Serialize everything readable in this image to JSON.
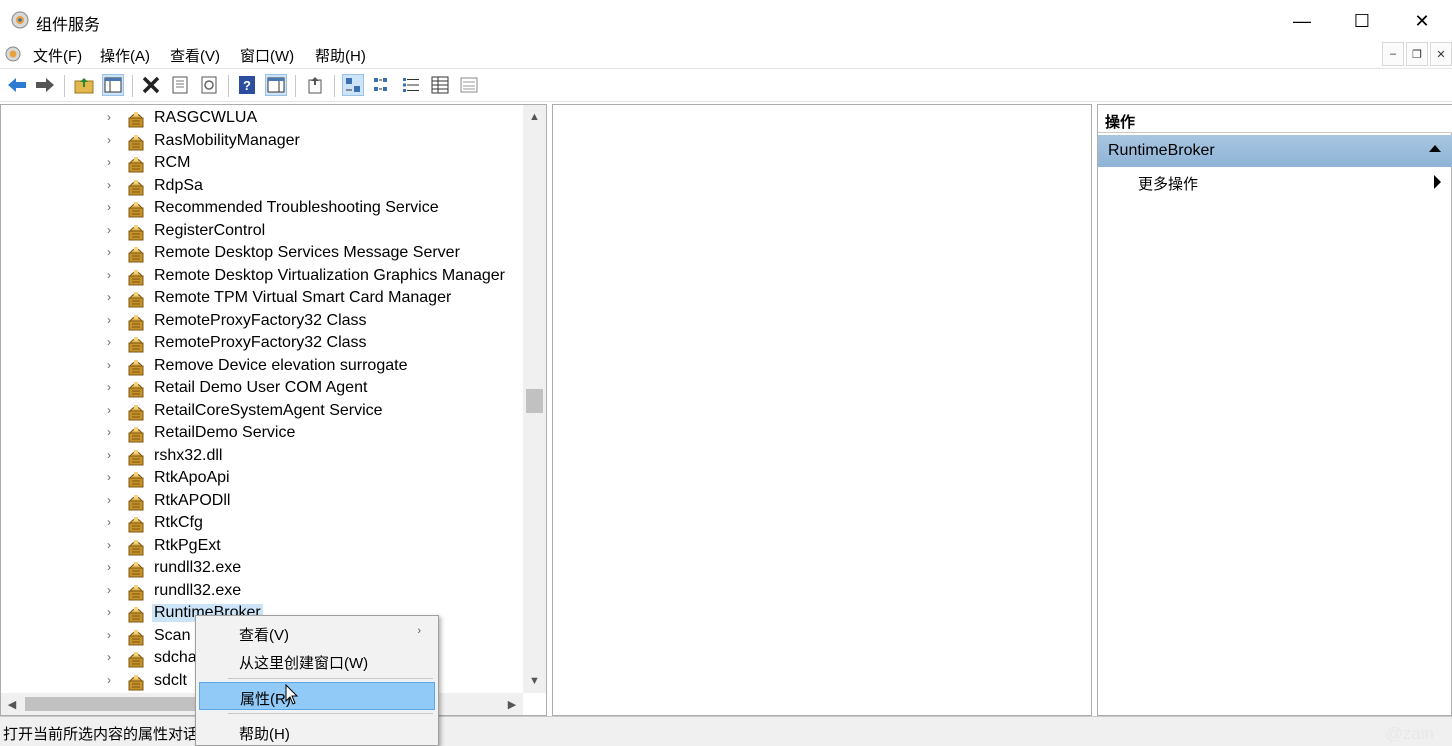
{
  "window": {
    "title": "组件服务",
    "controls": {
      "minimize": "—",
      "maximize": "☐",
      "close": "✕"
    }
  },
  "menubar": {
    "items": [
      "文件(F)",
      "操作(A)",
      "查看(V)",
      "窗口(W)",
      "帮助(H)"
    ]
  },
  "toolbar": {
    "buttons": [
      "back-arrow-icon",
      "forward-arrow-icon",
      "up-folder-icon",
      "show-hide-console-tree-icon",
      "delete-icon",
      "properties-icon",
      "refresh-icon",
      "help-icon",
      "show-hide-action-pane-icon",
      "export-list-icon",
      "large-icons-view-icon",
      "small-icons-view-icon",
      "list-view-icon",
      "detail-view-icon",
      "status-view-icon"
    ]
  },
  "tree": {
    "items": [
      "RASGCWLUA",
      "RasMobilityManager",
      "RCM",
      "RdpSa",
      "Recommended Troubleshooting Service",
      "RegisterControl",
      "Remote Desktop Services Message Server",
      "Remote Desktop Virtualization Graphics Manager",
      "Remote TPM Virtual Smart Card Manager",
      "RemoteProxyFactory32 Class",
      "RemoteProxyFactory32 Class",
      "Remove Device elevation surrogate",
      "Retail Demo User COM Agent",
      "RetailCoreSystemAgent Service",
      "RetailDemo Service",
      "rshx32.dll",
      "RtkApoApi",
      "RtkAPODll",
      "RtkCfg",
      "RtkPgExt",
      "rundll32.exe",
      "rundll32.exe",
      "RuntimeBroker",
      "Scan",
      "sdchange",
      "sdclt"
    ],
    "selected_index": 22
  },
  "actions": {
    "header": "操作",
    "section_title": "RuntimeBroker",
    "more_actions": "更多操作"
  },
  "context_menu": {
    "view": "查看(V)",
    "new_window": "从这里创建窗口(W)",
    "properties": "属性(R)",
    "help": "帮助(H)"
  },
  "status": {
    "text": "打开当前所选内容的属性对话框。",
    "watermark": "@zain"
  },
  "colors": {
    "selection": "#cce4f7",
    "menu_hover": "#91c9f7",
    "action_section": "#a8c6e0"
  }
}
